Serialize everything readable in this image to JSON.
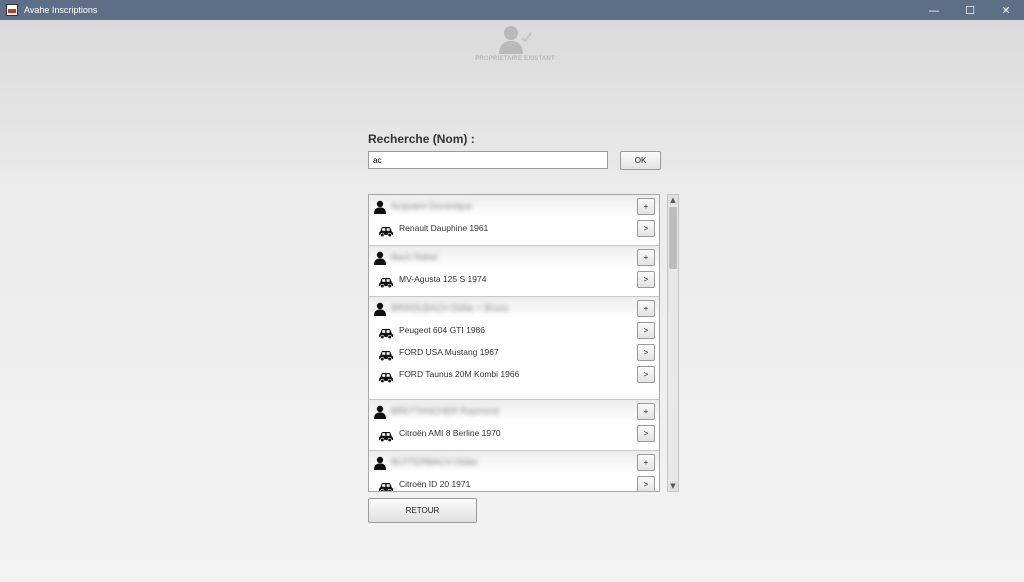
{
  "window": {
    "title": "Avahe Inscriptions",
    "controls": {
      "minimize": "—",
      "maximize": "☐",
      "close": "✕"
    }
  },
  "header": {
    "label": "PROPRIETAIRE EXISTANT",
    "icon": "person-check-icon"
  },
  "search": {
    "label": "Recherche (Nom) :",
    "value": "ac",
    "ok_label": "OK"
  },
  "results": [
    {
      "owner": "Acquaire Dominique",
      "add_label": "+",
      "cars": [
        {
          "name": "Renault Dauphine 1961",
          "open_label": ">"
        }
      ]
    },
    {
      "owner": "Bach Rahel",
      "add_label": "+",
      "cars": [
        {
          "name": "MV-Agusta 125 S 1974",
          "open_label": ">"
        }
      ]
    },
    {
      "owner": "BRINSLBACH Didier + Bruno",
      "add_label": "+",
      "cars": [
        {
          "name": "Peugeot 604 GTI 1986",
          "open_label": ">"
        },
        {
          "name": "FORD USA Mustang 1967",
          "open_label": ">"
        },
        {
          "name": "FORD Taunus 20M Kombi 1966",
          "open_label": ">"
        }
      ]
    },
    {
      "owner": "BRETTANCHER Raymond",
      "add_label": "+",
      "cars": [
        {
          "name": "Citroën AMI 8 Berline 1970",
          "open_label": ">"
        }
      ]
    },
    {
      "owner": "BUTTERBACH Didier",
      "add_label": "+",
      "cars": [
        {
          "name": "Citroën ID 20 1971",
          "open_label": ">"
        }
      ]
    }
  ],
  "scrollbar": {
    "up": "▲",
    "down": "▼"
  },
  "back_label": "RETOUR"
}
